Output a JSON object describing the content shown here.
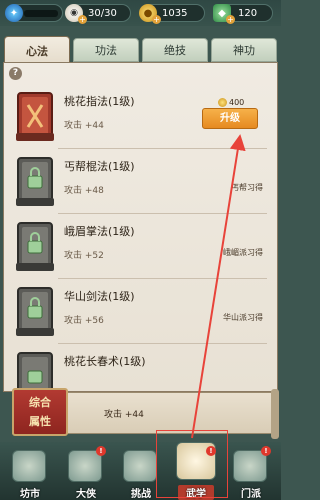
{
  "resources": {
    "level_value": "",
    "stamina": "30/30",
    "gold": "1035",
    "jade": "120"
  },
  "tabs": [
    "心法",
    "功法",
    "绝技",
    "神功"
  ],
  "skills": [
    {
      "name": "桃花指法(1级)",
      "attr": "攻击 +44",
      "cost": "400",
      "action": "升级",
      "source": ""
    },
    {
      "name": "丐帮棍法(1级)",
      "attr": "攻击 +48",
      "cost": "",
      "action": "",
      "source": "丐帮习得"
    },
    {
      "name": "峨眉掌法(1级)",
      "attr": "攻击 +52",
      "cost": "",
      "action": "",
      "source": "峨嵋派习得"
    },
    {
      "name": "华山剑法(1级)",
      "attr": "攻击 +56",
      "cost": "",
      "action": "",
      "source": "华山派习得"
    },
    {
      "name": "桃花长春术(1级)",
      "attr": "",
      "cost": "",
      "action": "",
      "source": ""
    }
  ],
  "summary": {
    "label_line1": "综合",
    "label_line2": "属性",
    "stat": "攻击 +44"
  },
  "nav": [
    {
      "label": "坊市",
      "badge": ""
    },
    {
      "label": "大侠",
      "badge": "!"
    },
    {
      "label": "挑战",
      "badge": ""
    },
    {
      "label": "武学",
      "badge": "!"
    },
    {
      "label": "门派",
      "badge": "!"
    }
  ],
  "colors": {
    "upgrade_button": "#e68a20",
    "annotation": "#e8433a",
    "summary_badge": "#b23a32"
  }
}
